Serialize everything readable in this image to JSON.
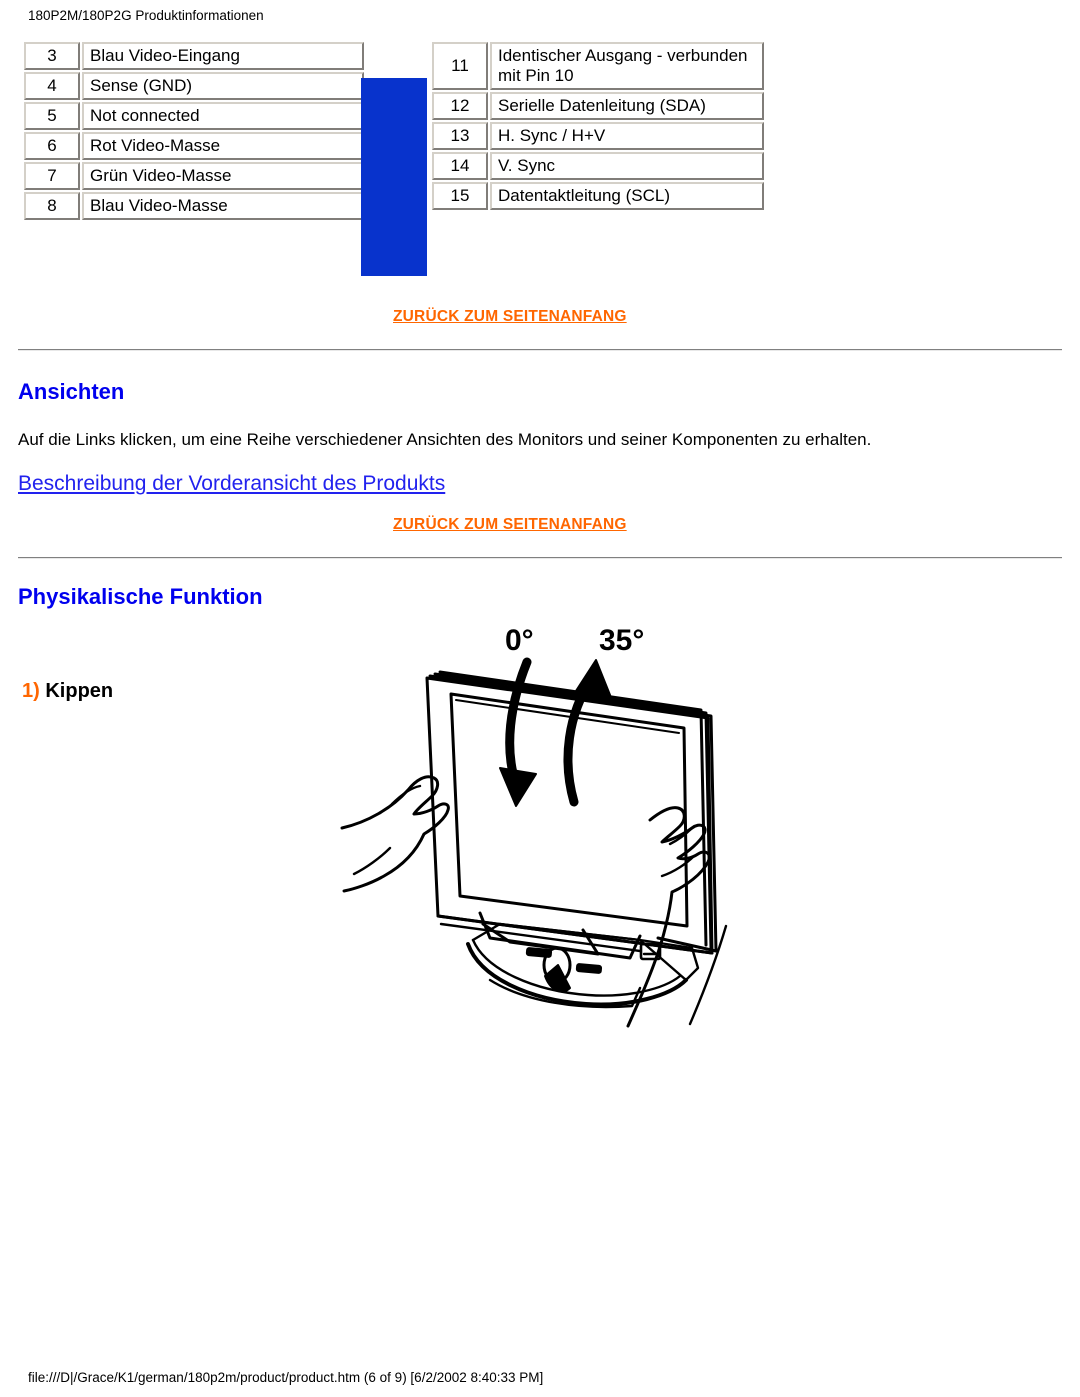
{
  "header": {
    "title": "180P2M/180P2G Produktinformationen"
  },
  "pin_tables": {
    "left": [
      {
        "pin": "3",
        "desc": "Blau Video-Eingang"
      },
      {
        "pin": "4",
        "desc": "Sense (GND)"
      },
      {
        "pin": "5",
        "desc": "Not connected"
      },
      {
        "pin": "6",
        "desc": "Rot Video-Masse"
      },
      {
        "pin": "7",
        "desc": "Grün Video-Masse"
      },
      {
        "pin": "8",
        "desc": "Blau Video-Masse"
      }
    ],
    "right": [
      {
        "pin": "11",
        "desc": "Identischer Ausgang - verbunden mit Pin 10"
      },
      {
        "pin": "12",
        "desc": "Serielle Datenleitung (SDA)"
      },
      {
        "pin": "13",
        "desc": "H. Sync / H+V"
      },
      {
        "pin": "14",
        "desc": "V. Sync"
      },
      {
        "pin": "15",
        "desc": "Datentaktleitung (SCL)"
      }
    ],
    "accent_color": "#0833cc"
  },
  "links": {
    "back_to_top": "ZURÜCK ZUM SEITENANFANG",
    "back_to_top_color": "#ff6600",
    "front_view": "Beschreibung der Vorderansicht des Produkts",
    "front_view_color": "#2222ee"
  },
  "sections": {
    "views": {
      "heading": "Ansichten",
      "heading_color": "#0000ee",
      "paragraph": "Auf die Links klicken, um eine Reihe verschiedener Ansichten des Monitors und seiner Komponenten zu erhalten."
    },
    "physical": {
      "heading": "Physikalische Funktion",
      "heading_color": "#0000ee",
      "item_number": "1)",
      "item_label": "Kippen",
      "item_number_color": "#ff6600"
    }
  },
  "illustration": {
    "name": "monitor-tilt-diagram",
    "angle_min": "0°",
    "angle_max": "35°"
  },
  "footer": {
    "path": "file:///D|/Grace/K1/german/180p2m/product/product.htm (6 of 9) [6/2/2002 8:40:33 PM]"
  }
}
